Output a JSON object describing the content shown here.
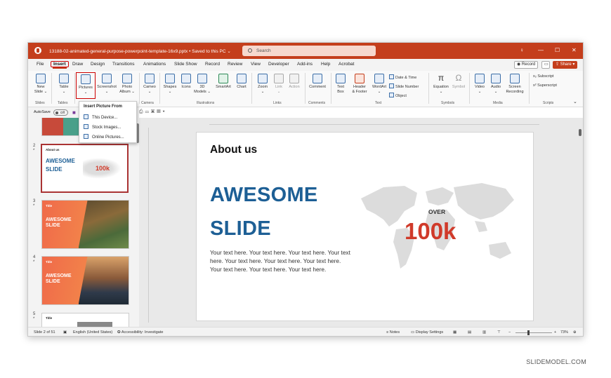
{
  "window": {
    "file_title": "13188-02-animated-general-purpose-powerpoint-template-16x9.pptx • Saved to this PC ⌄",
    "search_placeholder": "Search",
    "controls": {
      "min": "—",
      "max": "☐",
      "close": "✕"
    }
  },
  "menu": {
    "tabs": [
      "File",
      "Insert",
      "Draw",
      "Design",
      "Transitions",
      "Animations",
      "Slide Show",
      "Record",
      "Review",
      "View",
      "Developer",
      "Add-ins",
      "Help",
      "Acrobat"
    ],
    "active": "Insert",
    "record_label": "Record",
    "share_label": "Share"
  },
  "ribbon": {
    "buttons": [
      {
        "label": "New\nSlide ⌄",
        "icon": "new-slide-icon"
      },
      {
        "label": "Table\n⌄",
        "icon": "table-icon"
      },
      {
        "label": "Pictures\n⌄",
        "icon": "pictures-icon"
      },
      {
        "label": "Screenshot\n⌄",
        "icon": "screenshot-icon"
      },
      {
        "label": "Photo\nAlbum ⌄",
        "icon": "photo-album-icon"
      },
      {
        "label": "Cameo\n⌄",
        "icon": "cameo-icon"
      },
      {
        "label": "Shapes\n⌄",
        "icon": "shapes-icon"
      },
      {
        "label": "Icons",
        "icon": "icons-icon"
      },
      {
        "label": "3D\nModels ⌄",
        "icon": "3d-models-icon"
      },
      {
        "label": "SmartArt",
        "icon": "smartart-icon"
      },
      {
        "label": "Chart",
        "icon": "chart-icon"
      },
      {
        "label": "Zoom\n⌄",
        "icon": "zoom-icon"
      },
      {
        "label": "Link\n⌄",
        "icon": "link-icon"
      },
      {
        "label": "Action",
        "icon": "action-icon"
      },
      {
        "label": "Comment",
        "icon": "comment-icon"
      },
      {
        "label": "Text\nBox",
        "icon": "text-box-icon"
      },
      {
        "label": "Header\n& Footer",
        "icon": "header-footer-icon"
      },
      {
        "label": "WordArt\n⌄",
        "icon": "wordart-icon"
      },
      {
        "label": "Equation\n⌄",
        "icon": "equation-icon"
      },
      {
        "label": "Symbol",
        "icon": "symbol-icon"
      },
      {
        "label": "Video\n⌄",
        "icon": "video-icon"
      },
      {
        "label": "Audio\n⌄",
        "icon": "audio-icon"
      },
      {
        "label": "Screen\nRecording",
        "icon": "screen-recording-icon"
      }
    ],
    "small_buttons": [
      "Date & Time",
      "Slide Number",
      "Object",
      "Subscript",
      "Superscript"
    ],
    "groups": [
      "Slides",
      "Tables",
      "Camera",
      "Illustrations",
      "Links",
      "Comments",
      "Text",
      "Symbols",
      "Media",
      "Scripts"
    ]
  },
  "qat": {
    "autosave": "AutoSave",
    "toggle": "Off"
  },
  "dropdown": {
    "header": "Insert Picture From",
    "items": [
      "This Device...",
      "Stock Images...",
      "Online Pictures..."
    ]
  },
  "thumbnails": [
    {
      "num": "2",
      "title": "About us",
      "headline": "AWESOME\nSLIDE",
      "value": "100k"
    },
    {
      "num": "3",
      "title": "Title",
      "headline": "AWESOME\nSLIDE"
    },
    {
      "num": "4",
      "title": "Title",
      "headline": "AWESOME\nSLIDE"
    },
    {
      "num": "5",
      "title": "Title"
    }
  ],
  "slide": {
    "heading": "About us",
    "line1": "AWESOME",
    "line2": "SLIDE",
    "body": "Your text here. Your text here. Your text here. Your text here. Your text here. Your text here. Your text here. Your text here. Your text here. Your text here.",
    "over": "OVER",
    "value": "100k"
  },
  "status": {
    "slide_of": "Slide 2 of 51",
    "language": "English (United States)",
    "accessibility": "Accessibility: Investigate",
    "notes": "Notes",
    "display": "Display Settings",
    "zoom": "73%"
  },
  "brand": "SLIDEMODEL.COM",
  "colors": {
    "accent": "#c43e1c",
    "headline": "#1d5f95",
    "number": "#d03a2a"
  }
}
